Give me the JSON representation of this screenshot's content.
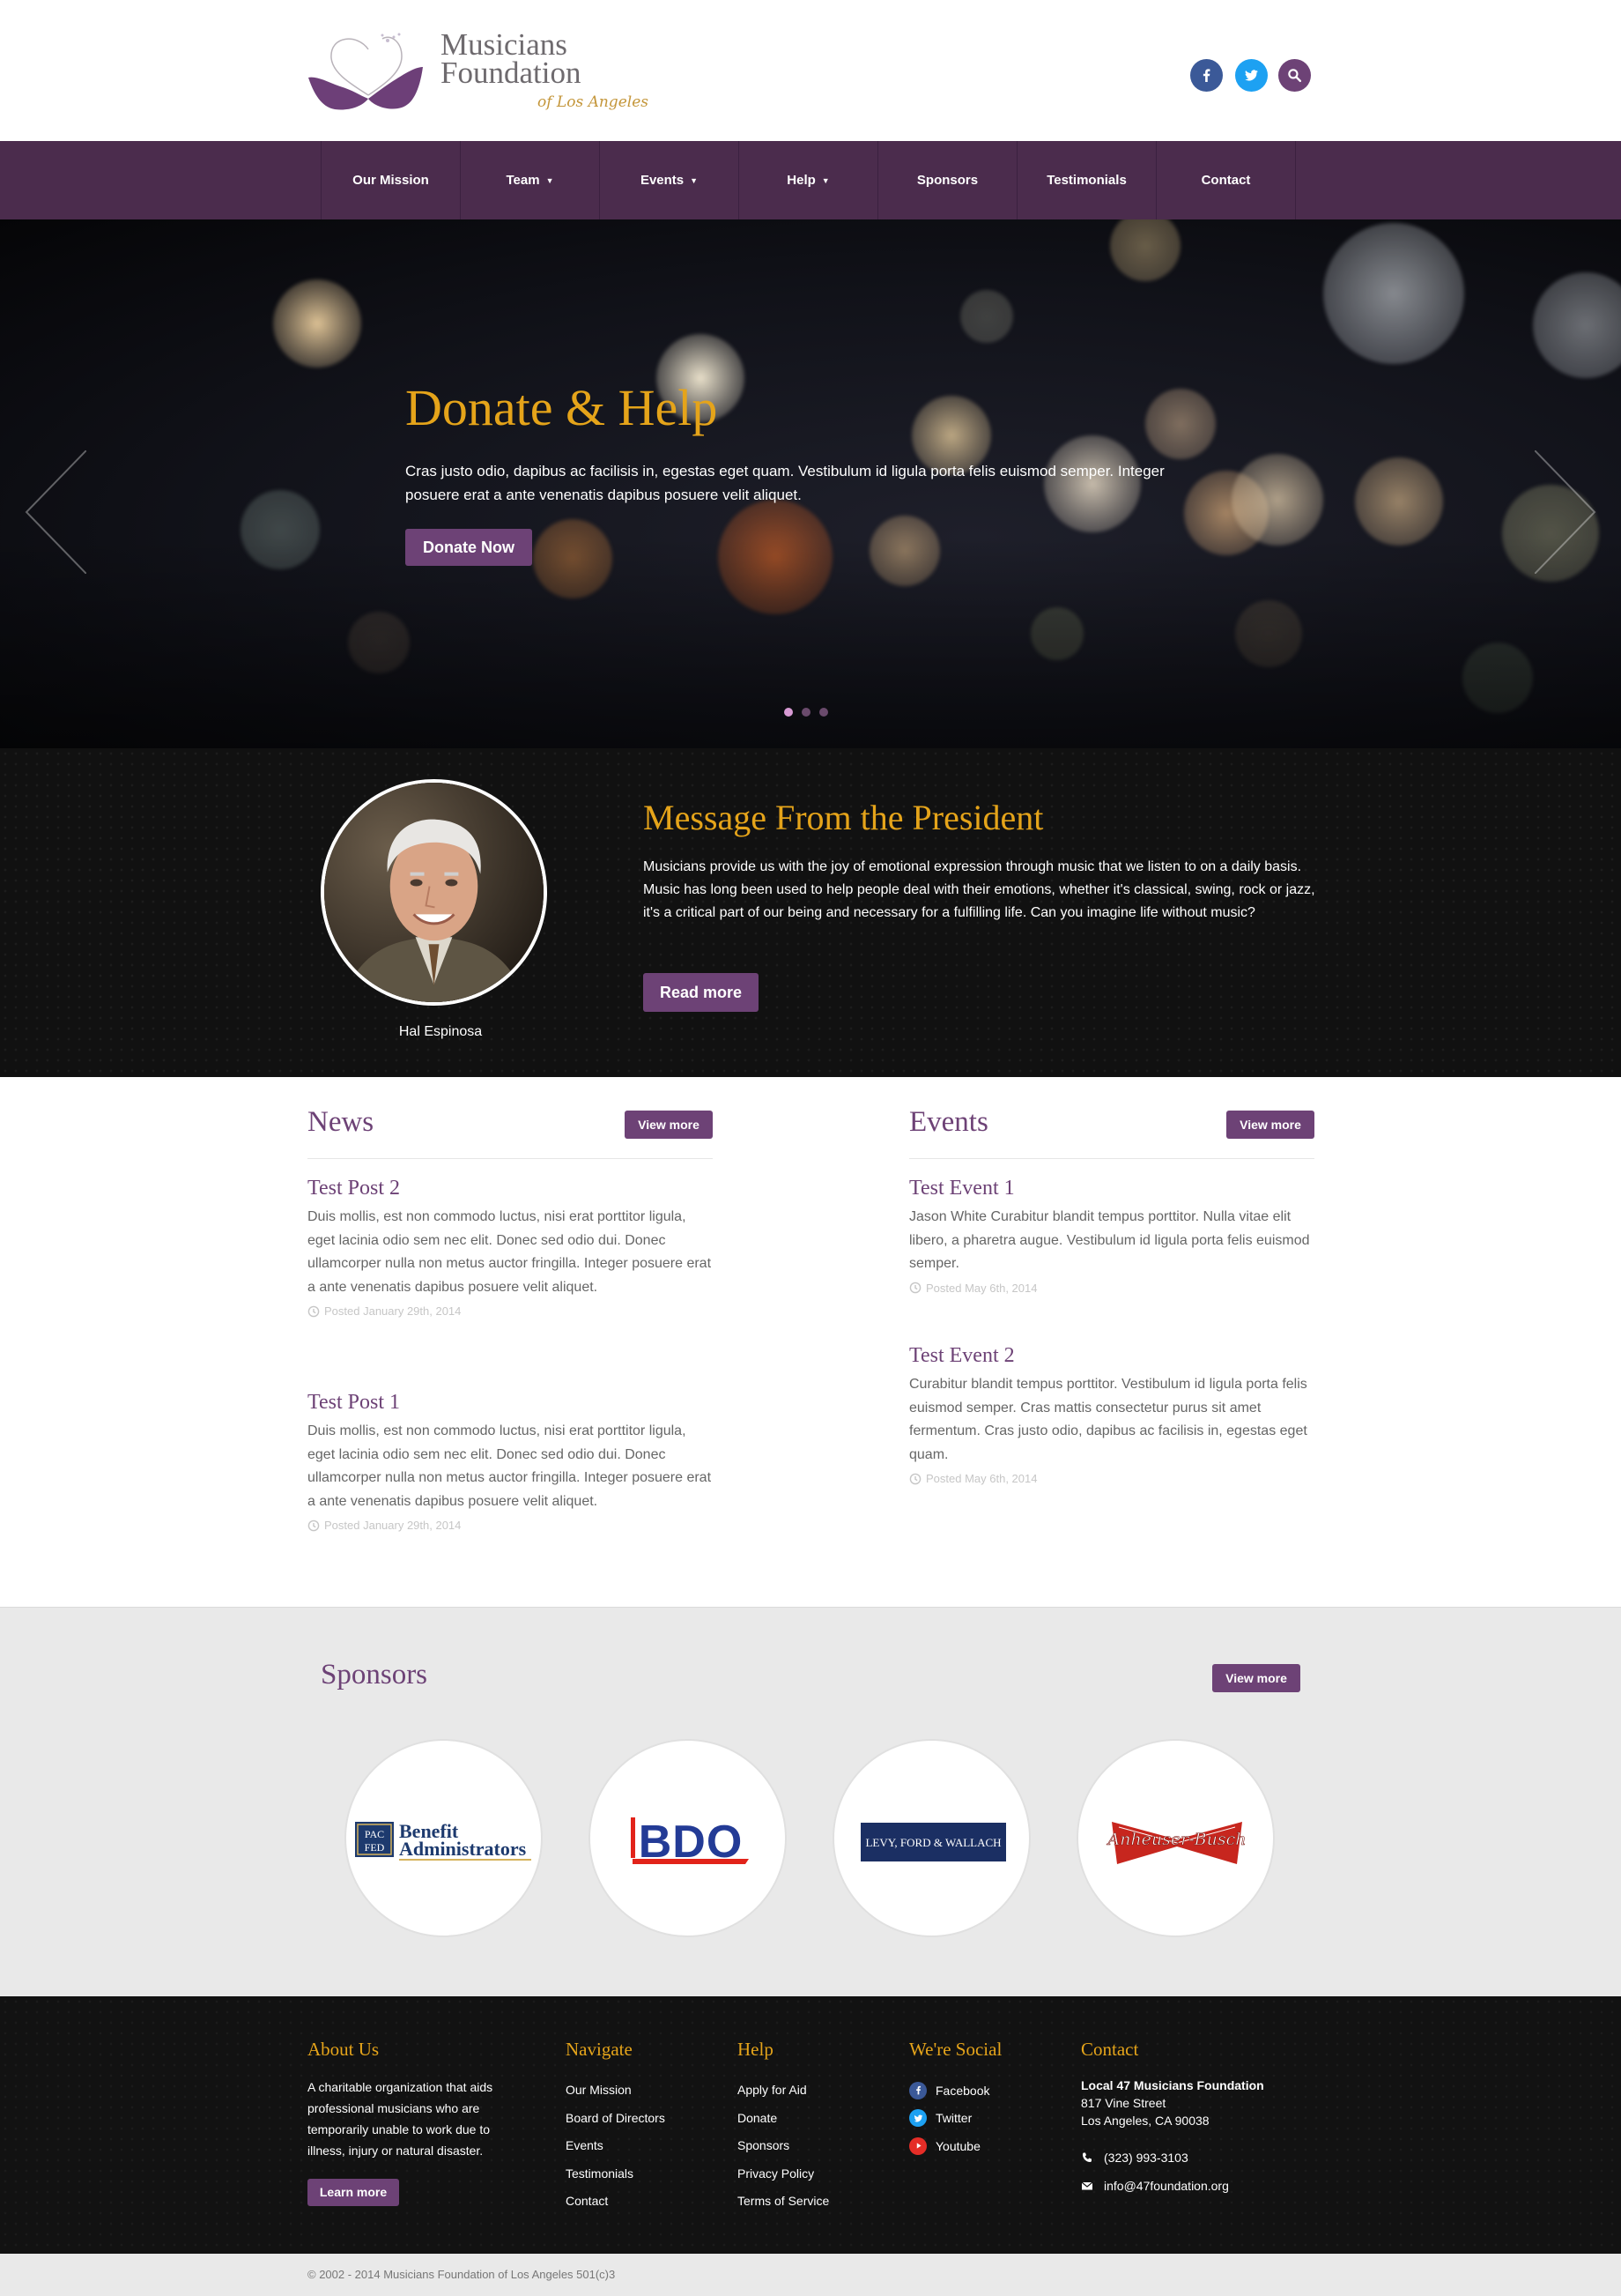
{
  "brand": {
    "line1": "Musicians",
    "line2": "Foundation",
    "line3": "of Los Angeles"
  },
  "header": {
    "social": [
      {
        "name": "facebook-icon",
        "color": "#3b5998"
      },
      {
        "name": "twitter-icon",
        "color": "#1da1f2"
      },
      {
        "name": "search-icon",
        "color": "#6d4276"
      }
    ]
  },
  "nav": {
    "items": [
      {
        "label": "Our Mission",
        "dropdown": false
      },
      {
        "label": "Team",
        "dropdown": true
      },
      {
        "label": "Events",
        "dropdown": true
      },
      {
        "label": "Help",
        "dropdown": true
      },
      {
        "label": "Sponsors",
        "dropdown": false
      },
      {
        "label": "Testimonials",
        "dropdown": false
      },
      {
        "label": "Contact",
        "dropdown": false
      }
    ],
    "caret": "▼"
  },
  "hero": {
    "title": "Donate & Help",
    "text": "Cras justo odio, dapibus ac facilisis in, egestas eget quam. Vestibulum id ligula porta felis euismod semper. Integer posuere erat a ante venenatis dapibus posuere velit aliquet.",
    "button": "Donate Now",
    "slides": 3,
    "active_slide": 1
  },
  "president": {
    "title": "Message From the President",
    "text": "Musicians provide us with the joy of emotional expression through music that we listen to on a daily basis. Music has long been used to help people deal with their emotions, whether it's classical, swing, rock or jazz, it's a critical part of our being and necessary for a fulfilling life. Can you imagine life without music?",
    "button": "Read more",
    "name": "Hal Espinosa"
  },
  "news": {
    "title": "News",
    "button": "View more",
    "posts": [
      {
        "title": "Test Post 2",
        "text": "Duis mollis, est non commodo luctus, nisi erat porttitor ligula, eget lacinia odio sem nec elit. Donec sed odio dui. Donec ullamcorper nulla non metus auctor fringilla. Integer posuere erat a ante venenatis dapibus posuere velit aliquet.",
        "date": "Posted January 29th, 2014"
      },
      {
        "title": "Test Post 1",
        "text": "Duis mollis, est non commodo luctus, nisi erat porttitor ligula, eget lacinia odio sem nec elit. Donec sed odio dui. Donec ullamcorper nulla non metus auctor fringilla. Integer posuere erat a ante venenatis dapibus posuere velit aliquet.",
        "date": "Posted January 29th, 2014"
      }
    ]
  },
  "events": {
    "title": "Events",
    "button": "View more",
    "posts": [
      {
        "title": "Test Event 1",
        "text": "Jason White Curabitur blandit tempus porttitor. Nulla vitae elit libero, a pharetra augue. Vestibulum id ligula porta felis euismod semper.",
        "date": "Posted May 6th, 2014"
      },
      {
        "title": "Test Event 2",
        "text": "Curabitur blandit tempus porttitor. Vestibulum id ligula porta felis euismod semper. Cras mattis consectetur purus sit amet fermentum. Cras justo odio, dapibus ac facilisis in, egestas eget quam.",
        "date": "Posted May 6th, 2014"
      }
    ]
  },
  "sponsors": {
    "title": "Sponsors",
    "button": "View more",
    "logos": [
      {
        "name": "pacfed-logo",
        "line1": "PAC",
        "line2": "FED",
        "text1": "Benefit",
        "text2": "Administrators"
      },
      {
        "name": "bdo-logo",
        "text": "BDO"
      },
      {
        "name": "lfw-logo",
        "text": "LEVY, FORD & WALLACH"
      },
      {
        "name": "anheuser-busch-logo",
        "text": "Anheuser-Busch"
      }
    ]
  },
  "footer": {
    "about": {
      "title": "About Us",
      "text": "A charitable organization that aids professional musicians who are temporarily unable to work due to illness, injury or natural disaster.",
      "button": "Learn more"
    },
    "navigate": {
      "title": "Navigate",
      "links": [
        "Our Mission",
        "Board of Directors",
        "Events",
        "Testimonials",
        "Contact"
      ]
    },
    "help": {
      "title": "Help",
      "links": [
        "Apply for Aid",
        "Donate",
        "Sponsors",
        "Privacy Policy",
        "Terms of Service"
      ]
    },
    "social": {
      "title": "We're Social",
      "links": [
        {
          "label": "Facebook",
          "icon": "facebook-icon",
          "color": "#3b5998"
        },
        {
          "label": "Twitter",
          "icon": "twitter-icon",
          "color": "#1da1f2"
        },
        {
          "label": "Youtube",
          "icon": "youtube-icon",
          "color": "#e52d27"
        }
      ]
    },
    "contact": {
      "title": "Contact",
      "org": "Local 47 Musicians Foundation",
      "street": "817 Vine Street",
      "city": "Los Angeles, CA 90038",
      "phone": "(323) 993-3103",
      "email": "info@47foundation.org"
    }
  },
  "copyright": "© 2002 - 2014 Musicians Foundation of Los Angeles 501(c)3",
  "colors": {
    "purple": "#6d4276",
    "nav": "#4b2c4d",
    "gold": "#e5a41a"
  }
}
